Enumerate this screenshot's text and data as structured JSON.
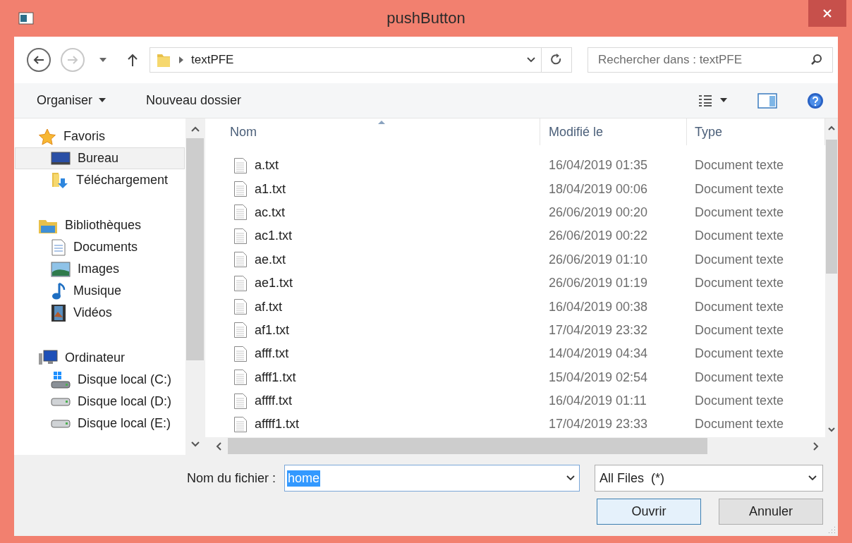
{
  "window": {
    "title": "pushButton"
  },
  "navigation": {
    "back": {
      "disabled": false
    },
    "forward": {
      "disabled": true
    }
  },
  "address_bar": {
    "path": [
      "textPFE"
    ]
  },
  "search": {
    "placeholder": "Rechercher dans : textPFE"
  },
  "toolbar": {
    "items": [
      {
        "label": "Organiser",
        "kind": "menu"
      },
      {
        "label": "Nouveau dossier",
        "kind": "button"
      }
    ]
  },
  "sidebar": {
    "groups": [
      {
        "label": "Favoris",
        "children": [
          {
            "label": "Bureau",
            "selected": true
          },
          {
            "label": "Téléchargement",
            "selected": false
          }
        ]
      },
      {
        "label": "Bibliothèques",
        "children": [
          {
            "label": "Documents",
            "selected": false
          },
          {
            "label": "Images",
            "selected": false
          },
          {
            "label": "Musique",
            "selected": false
          },
          {
            "label": "Vidéos",
            "selected": false
          }
        ]
      },
      {
        "label": "Ordinateur",
        "children": [
          {
            "label": "Disque local (C:)",
            "selected": false
          },
          {
            "label": "Disque local (D:)",
            "selected": false
          },
          {
            "label": "Disque local (E:)",
            "selected": false
          }
        ]
      }
    ]
  },
  "file_list": {
    "columns": [
      "Nom",
      "Modifié le",
      "Type"
    ],
    "rows": [
      {
        "name": "a.txt",
        "modified": "16/04/2019 01:35",
        "type": "Document texte"
      },
      {
        "name": "a1.txt",
        "modified": "18/04/2019 00:06",
        "type": "Document texte"
      },
      {
        "name": "ac.txt",
        "modified": "26/06/2019 00:20",
        "type": "Document texte"
      },
      {
        "name": "ac1.txt",
        "modified": "26/06/2019 00:22",
        "type": "Document texte"
      },
      {
        "name": "ae.txt",
        "modified": "26/06/2019 01:10",
        "type": "Document texte"
      },
      {
        "name": "ae1.txt",
        "modified": "26/06/2019 01:19",
        "type": "Document texte"
      },
      {
        "name": "af.txt",
        "modified": "16/04/2019 00:38",
        "type": "Document texte"
      },
      {
        "name": "af1.txt",
        "modified": "17/04/2019 23:32",
        "type": "Document texte"
      },
      {
        "name": "afff.txt",
        "modified": "14/04/2019 04:34",
        "type": "Document texte"
      },
      {
        "name": "afff1.txt",
        "modified": "15/04/2019 02:54",
        "type": "Document texte"
      },
      {
        "name": "affff.txt",
        "modified": "16/04/2019 01:11",
        "type": "Document texte"
      },
      {
        "name": "affff1.txt",
        "modified": "17/04/2019 23:33",
        "type": "Document texte"
      }
    ]
  },
  "filename": {
    "label": "Nom du fichier :",
    "value": "home",
    "highlighted": true
  },
  "file_type": {
    "value": "All Files  (*)"
  },
  "buttons": [
    {
      "label": "Ouvrir",
      "default": true
    },
    {
      "label": "Annuler",
      "default": false
    }
  ]
}
